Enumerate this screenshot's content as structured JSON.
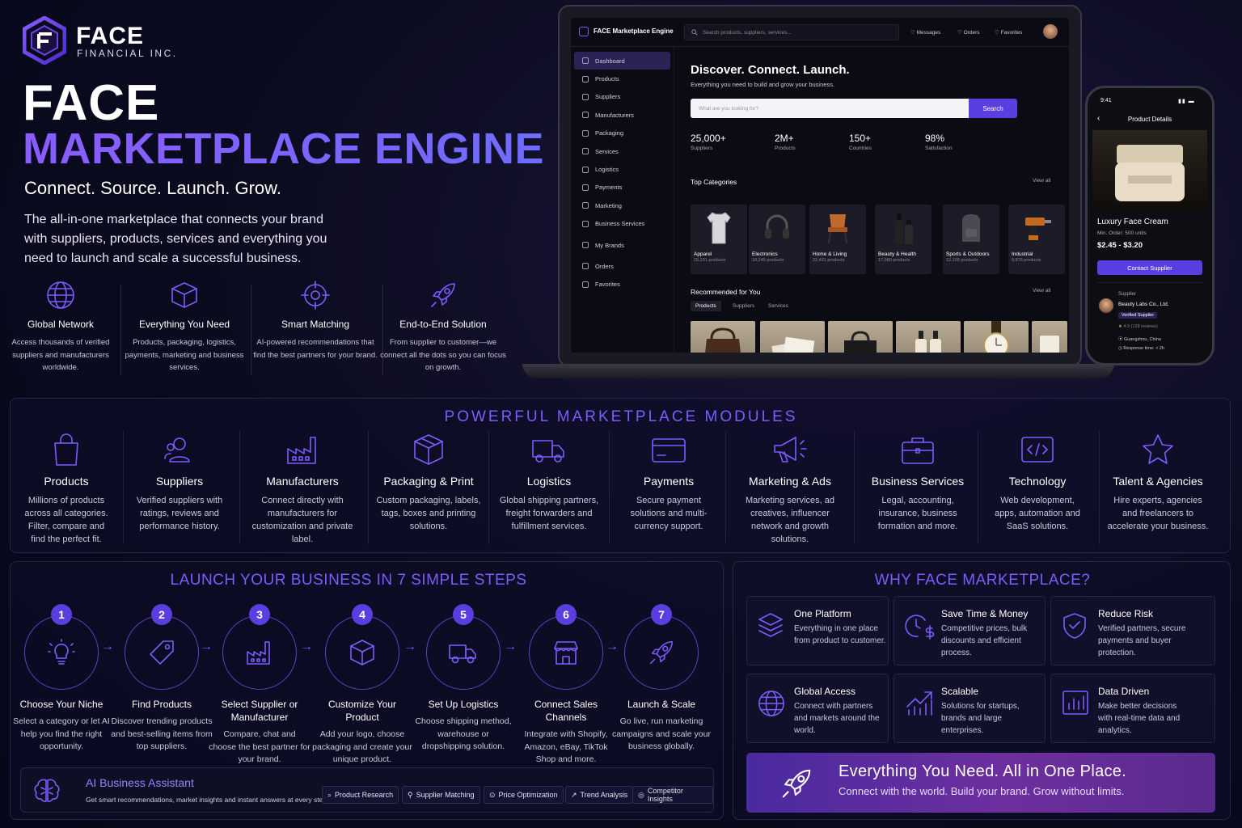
{
  "brand": {
    "name": "FACE",
    "sub": "FINANCIAL INC."
  },
  "hero": {
    "title": "FACE",
    "subtitle": "MARKETPLACE ENGINE",
    "tagline": "Connect. Source. Launch. Grow.",
    "description": "The all-in-one marketplace that connects your brand with suppliers, products, services and everything you need to launch and scale a successful business."
  },
  "features": [
    {
      "icon": "globe-icon",
      "title": "Global Network",
      "text": "Access thousands of verified suppliers and manufacturers worldwide."
    },
    {
      "icon": "box-icon",
      "title": "Everything You Need",
      "text": "Products, packaging, logistics, payments, marketing and business services."
    },
    {
      "icon": "target-icon",
      "title": "Smart Matching",
      "text": "AI-powered recommendations that find the best partners for your brand."
    },
    {
      "icon": "rocket-icon",
      "title": "End-to-End Solution",
      "text": "From supplier to customer—we connect all the dots so you can focus on growth."
    }
  ],
  "app": {
    "title": "FACE Marketplace Engine",
    "search_placeholder": "Search products, suppliers, services...",
    "nav": {
      "messages": "Messages",
      "orders": "Orders",
      "favorites": "Favorites"
    },
    "sidebar": [
      "Dashboard",
      "Products",
      "Suppliers",
      "Manufacturers",
      "Packaging",
      "Services",
      "Logistics",
      "Payments",
      "Marketing",
      "Business Services",
      "My Brands",
      "Orders",
      "Favorites"
    ],
    "heading": "Discover. Connect. Launch.",
    "subheading": "Everything you need to build and grow your business.",
    "main_search_placeholder": "What are you looking for?",
    "search_button": "Search",
    "stats": [
      {
        "value": "25,000+",
        "label": "Suppliers"
      },
      {
        "value": "2M+",
        "label": "Products"
      },
      {
        "value": "150+",
        "label": "Countries"
      },
      {
        "value": "98%",
        "label": "Satisfaction"
      }
    ],
    "top_categories": "Top Categories",
    "view_all": "View all",
    "categories": [
      {
        "name": "Apparel",
        "count": "15,231 products"
      },
      {
        "name": "Electronics",
        "count": "18,245 products"
      },
      {
        "name": "Home & Living",
        "count": "22,431 products"
      },
      {
        "name": "Beauty & Health",
        "count": "17,980 products"
      },
      {
        "name": "Sports & Outdoors",
        "count": "12,109 products"
      },
      {
        "name": "Industrial",
        "count": "9,876 products"
      }
    ],
    "recommended": "Recommended for You",
    "rec_tabs": [
      "Products",
      "Suppliers",
      "Services"
    ]
  },
  "phone": {
    "time": "9:41",
    "header": "Product Details",
    "product": "Luxury Face Cream",
    "min_order": "Min. Order: 500 units",
    "price": "$2.45 - $3.20",
    "contact": "Contact Supplier",
    "supplier_label": "Supplier",
    "supplier": "Beauty Labs Co., Ltd.",
    "verified": "Verified Supplier",
    "rating": "4.9 (128 reviews)",
    "location": "Guangzhou, China",
    "response": "Response time: < 2h"
  },
  "modules": {
    "title": "POWERFUL MARKETPLACE MODULES",
    "items": [
      {
        "icon": "shopping-bag-icon",
        "title": "Products",
        "text": "Millions of products across all categories. Filter, compare and find the perfect fit."
      },
      {
        "icon": "users-icon",
        "title": "Suppliers",
        "text": "Verified suppliers with ratings, reviews and performance history."
      },
      {
        "icon": "factory-icon",
        "title": "Manufacturers",
        "text": "Connect directly with manufacturers for customization and private label."
      },
      {
        "icon": "package-icon",
        "title": "Packaging & Print",
        "text": "Custom packaging, labels, tags, boxes and printing solutions."
      },
      {
        "icon": "truck-icon",
        "title": "Logistics",
        "text": "Global shipping partners, freight forwarders and fulfillment services."
      },
      {
        "icon": "credit-card-icon",
        "title": "Payments",
        "text": "Secure payment solutions and multi-currency support."
      },
      {
        "icon": "megaphone-icon",
        "title": "Marketing & Ads",
        "text": "Marketing services, ad creatives, influencer network and growth solutions."
      },
      {
        "icon": "briefcase-icon",
        "title": "Business Services",
        "text": "Legal, accounting, insurance, business formation and more."
      },
      {
        "icon": "code-icon",
        "title": "Technology",
        "text": "Web development, apps, automation and SaaS solutions."
      },
      {
        "icon": "star-icon",
        "title": "Talent & Agencies",
        "text": "Hire experts, agencies and freelancers to accelerate your business."
      }
    ]
  },
  "steps": {
    "title": "LAUNCH YOUR BUSINESS IN 7 SIMPLE STEPS",
    "items": [
      {
        "num": "1",
        "icon": "lightbulb-icon",
        "title": "Choose Your Niche",
        "text": "Select a category or let AI help you find the right opportunity."
      },
      {
        "num": "2",
        "icon": "tag-icon",
        "title": "Find Products",
        "text": "Discover trending products and best-selling items from top suppliers."
      },
      {
        "num": "3",
        "icon": "factory-icon",
        "title": "Select Supplier or Manufacturer",
        "text": "Compare, chat and choose the best partner for your brand."
      },
      {
        "num": "4",
        "icon": "package-icon",
        "title": "Customize Your Product",
        "text": "Add your logo, choose packaging and create your unique product."
      },
      {
        "num": "5",
        "icon": "truck-icon",
        "title": "Set Up Logistics",
        "text": "Choose shipping method, warehouse or dropshipping solution."
      },
      {
        "num": "6",
        "icon": "storefront-icon",
        "title": "Connect Sales Channels",
        "text": "Integrate with Shopify, Amazon, eBay, TikTok Shop and more."
      },
      {
        "num": "7",
        "icon": "rocket-icon",
        "title": "Launch & Scale",
        "text": "Go live, run marketing campaigns and scale your business globally."
      }
    ]
  },
  "ai": {
    "title": "AI Business Assistant",
    "text": "Get smart recommendations, market insights and instant answers at every step.",
    "chips": [
      "Product Research",
      "Supplier Matching",
      "Price Optimization",
      "Trend Analysis",
      "Competitor Insights"
    ]
  },
  "why": {
    "title": "WHY FACE MARKETPLACE?",
    "items": [
      {
        "icon": "layers-icon",
        "title": "One Platform",
        "text": "Everything in one place from product to customer."
      },
      {
        "icon": "clock-dollar-icon",
        "title": "Save Time & Money",
        "text": "Competitive prices, bulk discounts and efficient process."
      },
      {
        "icon": "shield-check-icon",
        "title": "Reduce Risk",
        "text": "Verified partners, secure payments and buyer protection."
      },
      {
        "icon": "globe-icon",
        "title": "Global Access",
        "text": "Connect with partners and markets around the world."
      },
      {
        "icon": "trend-up-icon",
        "title": "Scalable",
        "text": "Solutions for startups, brands and large enterprises."
      },
      {
        "icon": "bar-chart-icon",
        "title": "Data Driven",
        "text": "Make better decisions with real-time data and analytics."
      }
    ],
    "banner_title": "Everything You Need. All in One Place.",
    "banner_text": "Connect with the world. Build your brand. Grow without limits."
  }
}
